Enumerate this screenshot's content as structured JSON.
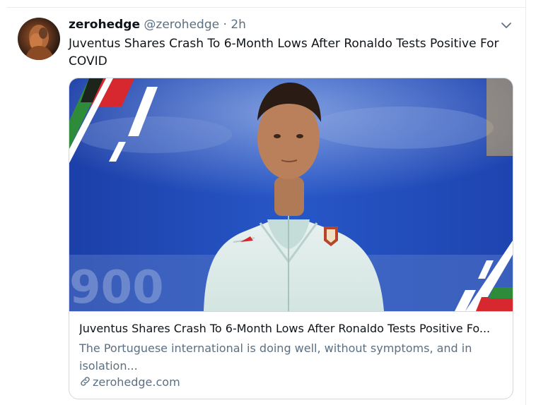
{
  "tweet": {
    "display_name": "zerohedge",
    "handle": "@zerohedge",
    "separator": "·",
    "timestamp": "2h",
    "text": "Juventus Shares Crash To 6-Month Lows After Ronaldo Tests Positive For COVID",
    "avatar_icon": "profile-avatar",
    "menu_icon": "chevron-down-icon"
  },
  "card": {
    "title": "Juventus Shares Crash To 6-Month Lows After Ronaldo Tests Positive Fo...",
    "description": "The Portuguese international is doing well, without symptoms, and in isolation...",
    "domain": "zerohedge.com",
    "domain_icon": "link-icon",
    "image_subject": "football player in white Portugal training jacket"
  },
  "colors": {
    "text_primary": "#0f1419",
    "text_secondary": "#5b7083",
    "border": "#cfd9de",
    "accent_green": "#2e8b3a",
    "accent_red": "#d6282e",
    "background_blue": "#1f4fbf"
  }
}
